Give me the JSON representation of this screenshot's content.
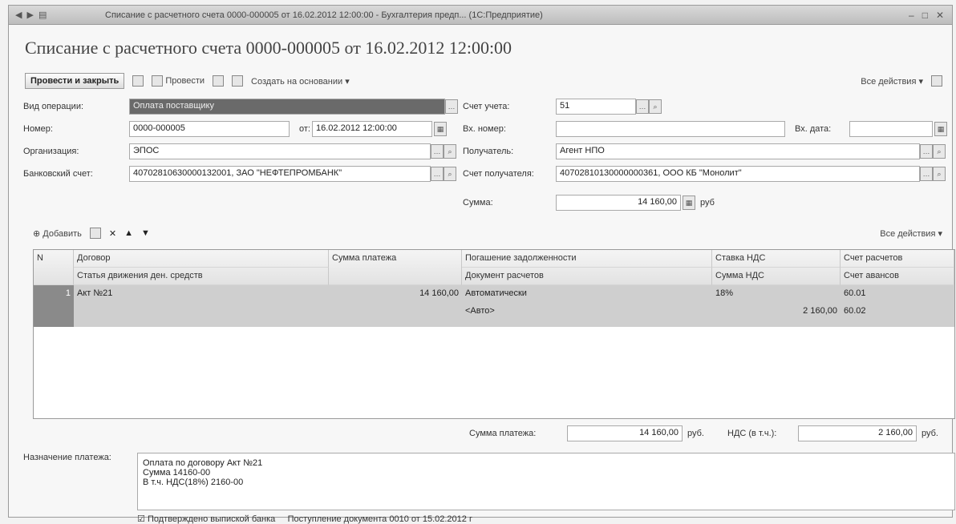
{
  "window": {
    "title": "Списание с расчетного счета 0000-000005 от 16.02.2012 12:00:00 - Бухгалтерия предп... (1С:Предприятие)"
  },
  "doc_title": "Списание с расчетного счета 0000-000005 от 16.02.2012 12:00:00",
  "toolbar": {
    "post_and_close": "Провести и закрыть",
    "post": "Провести",
    "create_based": "Создать на основании",
    "all_actions": "Все действия"
  },
  "form": {
    "operation_label": "Вид операции:",
    "operation_value": "Оплата поставщику",
    "number_label": "Номер:",
    "number_value": "0000-000005",
    "date_from_label": "от:",
    "date_value": "16.02.2012 12:00:00",
    "org_label": "Организация:",
    "org_value": "ЭПОС",
    "bank_label": "Банковский счет:",
    "bank_value": "40702810630000132001, ЗАО \"НЕФТЕПРОМБАНК\"",
    "account_label": "Счет учета:",
    "account_value": "51",
    "in_number_label": "Вх. номер:",
    "in_number_value": "",
    "in_date_label": "Вх. дата:",
    "in_date_value": "",
    "recipient_label": "Получатель:",
    "recipient_value": "Агент НПО",
    "recipient_account_label": "Счет получателя:",
    "recipient_account_value": "40702810130000000361, ООО КБ \"Монолит\"",
    "sum_label": "Сумма:",
    "sum_value": "14 160,00",
    "sum_unit": "руб"
  },
  "tab_toolbar": {
    "add": "Добавить",
    "all_actions": "Все действия"
  },
  "grid": {
    "headers_top": [
      "N",
      "Договор",
      "Сумма платежа",
      "Погашение задолженности",
      "Ставка НДС",
      "Счет расчетов"
    ],
    "headers_bottom": [
      "Статья движения ден. средств",
      "Документ расчетов",
      "Сумма НДС",
      "Счет авансов"
    ],
    "rows": [
      {
        "n": "1",
        "contract": "Акт №21",
        "cash_article": "",
        "payment_sum": "14 160,00",
        "debt_repayment": "Автоматически",
        "settlement_doc": "<Авто>",
        "vat_rate": "18%",
        "vat_sum": "2 160,00",
        "settlement_account": "60.01",
        "advance_account": "60.02"
      }
    ]
  },
  "totals": {
    "payment_sum_label": "Сумма платежа:",
    "payment_sum_value": "14 160,00",
    "payment_unit": "руб.",
    "vat_label": "НДС (в т.ч.):",
    "vat_value": "2 160,00",
    "vat_unit": "руб."
  },
  "purpose": {
    "label": "Назначение платежа:",
    "line1": "Оплата по договору Акт №21",
    "line2": "Сумма 14160-00",
    "line3": "В т.ч. НДС(18%) 2160-00"
  },
  "check": {
    "label": "Подтверждено выпиской банка",
    "note": "Поступление документа 0010 от 15.02.2012 г"
  }
}
